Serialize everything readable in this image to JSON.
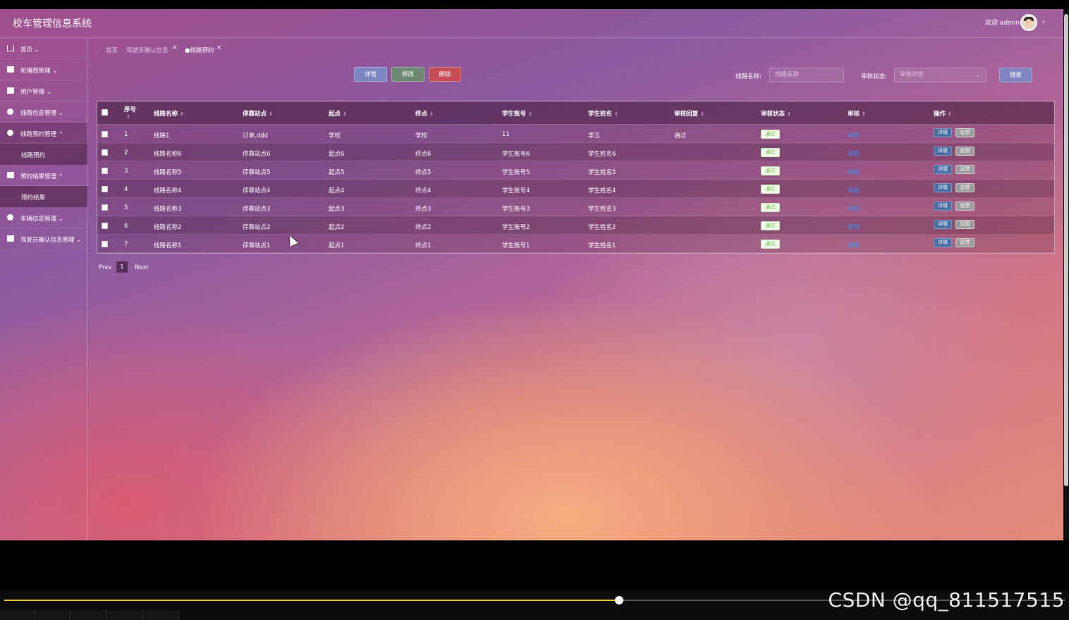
{
  "app": {
    "title": "校车管理信息系统",
    "welcome": "欢迎 admin"
  },
  "sidebar": {
    "items": [
      {
        "label": "首页",
        "icon": "home-icon",
        "chevron": "⌄"
      },
      {
        "label": "轮播图管理",
        "icon": "image-icon",
        "chevron": "⌄"
      },
      {
        "label": "用户管理",
        "icon": "users-icon",
        "chevron": "⌄"
      },
      {
        "label": "线路信息管理",
        "icon": "route-icon",
        "chevron": "⌄"
      },
      {
        "label": "线路预约管理",
        "icon": "booking-icon",
        "chevron": "⌃"
      },
      {
        "label": "预约结果管理",
        "icon": "result-icon",
        "chevron": "⌃"
      },
      {
        "label": "车辆信息管理",
        "icon": "bus-icon",
        "chevron": "⌄"
      },
      {
        "label": "驾驶员确认信息管理",
        "icon": "driver-icon",
        "chevron": "⌄"
      }
    ],
    "sub_booking": "线路预约",
    "sub_result": "预约结果"
  },
  "breadcrumb": {
    "home": "首页",
    "driver": "驾驶员确认信息",
    "current": "●线路预约",
    "close": "×"
  },
  "toolbar": {
    "detail": "详情",
    "edit": "修改",
    "delete": "删除",
    "search": "搜索"
  },
  "search": {
    "route_label": "线路名称:",
    "route_placeholder": "线路名称",
    "status_label": "审核状态:",
    "status_placeholder": "审核状态"
  },
  "table": {
    "headers": [
      "序号",
      "线路名称",
      "停靠站点",
      "起点",
      "终点",
      "学生账号",
      "学生姓名",
      "审核回复",
      "审核状态",
      "审核",
      "操作"
    ],
    "rows": [
      {
        "no": "1",
        "route": "线路1",
        "stops": "订单,ddd",
        "start": "学校",
        "end": "学校",
        "account": "11",
        "name": "李玉",
        "reply": "通过",
        "status": "通过",
        "audit": "审核"
      },
      {
        "no": "2",
        "route": "线路名称6",
        "stops": "停靠站点6",
        "start": "起点6",
        "end": "终点6",
        "account": "学生账号6",
        "name": "学生姓名6",
        "reply": "",
        "status": "通过",
        "audit": "审核"
      },
      {
        "no": "3",
        "route": "线路名称5",
        "stops": "停靠站点5",
        "start": "起点5",
        "end": "终点5",
        "account": "学生账号5",
        "name": "学生姓名5",
        "reply": "",
        "status": "通过",
        "audit": "审核"
      },
      {
        "no": "4",
        "route": "线路名称4",
        "stops": "停靠站点4",
        "start": "起点4",
        "end": "终点4",
        "account": "学生账号4",
        "name": "学生姓名4",
        "reply": "",
        "status": "通过",
        "audit": "审核"
      },
      {
        "no": "5",
        "route": "线路名称3",
        "stops": "停靠站点3",
        "start": "起点3",
        "end": "终点3",
        "account": "学生账号3",
        "name": "学生姓名3",
        "reply": "",
        "status": "通过",
        "audit": "审核"
      },
      {
        "no": "6",
        "route": "线路名称2",
        "stops": "停靠站点2",
        "start": "起点2",
        "end": "终点2",
        "account": "学生账号2",
        "name": "学生姓名2",
        "reply": "",
        "status": "通过",
        "audit": "审核"
      },
      {
        "no": "7",
        "route": "线路名称1",
        "stops": "停靠站点1",
        "start": "起点1",
        "end": "终点1",
        "account": "学生账号1",
        "name": "学生姓名1",
        "reply": "",
        "status": "通过",
        "audit": "审核"
      }
    ],
    "op_detail": "详情",
    "op_feedback": "反馈"
  },
  "pagination": {
    "prev": "Prev",
    "current": "1",
    "next": "Next"
  },
  "player": {
    "progress": 0.58
  },
  "watermark": "CSDN @qq_811517515",
  "colors": {
    "accent": "#7e86c2",
    "delete": "#c74b53",
    "edit": "#6b8a71",
    "link": "#3e8ef7",
    "badge": "#67c23a"
  }
}
